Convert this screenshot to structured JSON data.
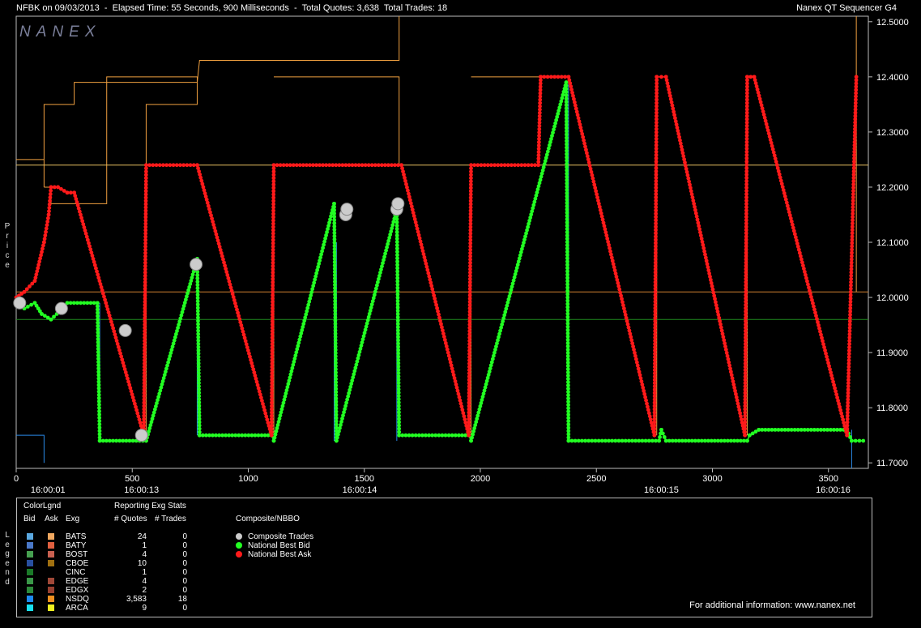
{
  "header": {
    "left": "NFBK on 09/03/2013  -  Elapsed Time: 55 Seconds, 900 Milliseconds  -  Total Quotes: 3,638  Total Trades: 18",
    "right": "Nanex QT Sequencer G4"
  },
  "watermark": "NANEX",
  "y_axis_label": "Price",
  "legend_side_label": "Legend",
  "chart_data": {
    "type": "scatter",
    "title": "",
    "ylim": [
      11.69,
      12.51
    ],
    "xlim": [
      0,
      3650
    ],
    "y_ticks": [
      "12.5000",
      "12.4000",
      "12.3000",
      "12.2000",
      "12.1000",
      "12.0000",
      "11.9000",
      "11.8000",
      "11.7000"
    ],
    "x_ticks": [
      0,
      500,
      1000,
      1500,
      2000,
      2500,
      3000,
      3500
    ],
    "time_labels": [
      {
        "x": 137,
        "label": "16:00:01"
      },
      {
        "x": 540,
        "label": "16:00:13"
      },
      {
        "x": 1480,
        "label": "16:00:14"
      },
      {
        "x": 2780,
        "label": "16:00:15"
      },
      {
        "x": 3520,
        "label": "16:00:16"
      }
    ],
    "series": [
      {
        "name": "National Best Ask",
        "color": "#ff1a1a",
        "points": [
          [
            0,
            12.0
          ],
          [
            35,
            12.01
          ],
          [
            80,
            12.03
          ],
          [
            120,
            12.1
          ],
          [
            140,
            12.15
          ],
          [
            150,
            12.2
          ],
          [
            180,
            12.2
          ],
          [
            220,
            12.19
          ],
          [
            250,
            12.19
          ],
          [
            550,
            11.75
          ],
          [
            560,
            12.24
          ],
          [
            780,
            12.24
          ],
          [
            1100,
            11.75
          ],
          [
            1110,
            12.24
          ],
          [
            1660,
            12.24
          ],
          [
            1950,
            11.75
          ],
          [
            1960,
            12.24
          ],
          [
            2250,
            12.24
          ],
          [
            2260,
            12.4
          ],
          [
            2380,
            12.4
          ],
          [
            2750,
            11.75
          ],
          [
            2760,
            12.4
          ],
          [
            2800,
            12.4
          ],
          [
            3140,
            11.75
          ],
          [
            3150,
            12.4
          ],
          [
            3180,
            12.4
          ],
          [
            3580,
            11.75
          ],
          [
            3620,
            12.4
          ]
        ]
      },
      {
        "name": "National Best Bid",
        "color": "#22ff22",
        "points": [
          [
            0,
            11.99
          ],
          [
            35,
            11.98
          ],
          [
            80,
            11.99
          ],
          [
            110,
            11.97
          ],
          [
            150,
            11.96
          ],
          [
            200,
            11.98
          ],
          [
            220,
            11.99
          ],
          [
            350,
            11.99
          ],
          [
            360,
            11.74
          ],
          [
            560,
            11.74
          ],
          [
            780,
            12.07
          ],
          [
            790,
            11.75
          ],
          [
            1100,
            11.75
          ],
          [
            1110,
            11.74
          ],
          [
            1370,
            12.17
          ],
          [
            1380,
            11.74
          ],
          [
            1640,
            12.16
          ],
          [
            1650,
            11.75
          ],
          [
            1950,
            11.75
          ],
          [
            1960,
            11.74
          ],
          [
            2370,
            12.39
          ],
          [
            2380,
            11.74
          ],
          [
            2770,
            11.74
          ],
          [
            2780,
            11.76
          ],
          [
            2800,
            11.74
          ],
          [
            3150,
            11.74
          ],
          [
            3160,
            11.75
          ],
          [
            3200,
            11.76
          ],
          [
            3580,
            11.76
          ],
          [
            3600,
            11.74
          ],
          [
            3650,
            11.74
          ]
        ]
      },
      {
        "name": "Composite Trades",
        "color": "#cccccc",
        "points": [
          [
            15,
            11.99
          ],
          [
            195,
            11.98
          ],
          [
            470,
            11.94
          ],
          [
            540,
            11.75
          ],
          [
            775,
            12.06
          ],
          [
            1420,
            12.15
          ],
          [
            1425,
            12.16
          ],
          [
            1640,
            12.16
          ],
          [
            1645,
            12.17
          ]
        ]
      }
    ],
    "reference_lines": [
      {
        "y": 12.24,
        "color": "#e8c060"
      },
      {
        "y": 12.01,
        "color": "#d08030"
      },
      {
        "y": 11.96,
        "color": "#1f8a1f"
      }
    ]
  },
  "legend": {
    "title": "ColorLgnd",
    "col_bid": "Bid",
    "col_ask": "Ask",
    "col_exg": "Exg",
    "stats_title": "Reporting Exg Stats",
    "col_quotes": "# Quotes",
    "col_trades": "# Trades",
    "composite_title": "Composite/NBBO",
    "rows": [
      {
        "exg": "BATS",
        "quotes": "24",
        "trades": "0",
        "bid": "#5aa8e0",
        "ask": "#f0a860"
      },
      {
        "exg": "BATY",
        "quotes": "1",
        "trades": "0",
        "bid": "#4a78c8",
        "ask": "#e06040"
      },
      {
        "exg": "BOST",
        "quotes": "4",
        "trades": "0",
        "bid": "#46a050",
        "ask": "#c86050"
      },
      {
        "exg": "CBOE",
        "quotes": "10",
        "trades": "0",
        "bid": "#2850a0",
        "ask": "#a07010"
      },
      {
        "exg": "CINC",
        "quotes": "1",
        "trades": "0",
        "bid": "#1a7a28",
        "ask": "#000000"
      },
      {
        "exg": "EDGE",
        "quotes": "4",
        "trades": "0",
        "bid": "#3a9848",
        "ask": "#a04838"
      },
      {
        "exg": "EDGX",
        "quotes": "2",
        "trades": "0",
        "bid": "#2c8a3a",
        "ask": "#984030"
      },
      {
        "exg": "NSDQ",
        "quotes": "3,583",
        "trades": "18",
        "bid": "#1e8af0",
        "ask": "#f09020"
      },
      {
        "exg": "ARCA",
        "quotes": "9",
        "trades": "0",
        "bid": "#18e0f0",
        "ask": "#f0f020"
      }
    ],
    "composite_items": [
      {
        "label": "Composite Trades",
        "color": "#cccccc"
      },
      {
        "label": "National Best Bid",
        "color": "#22ff22"
      },
      {
        "label": "National Best Ask",
        "color": "#ff1a1a"
      }
    ],
    "footer": "For additional information: www.nanex.net"
  }
}
